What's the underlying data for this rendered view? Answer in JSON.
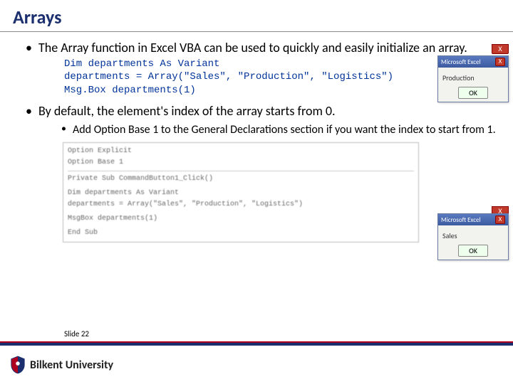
{
  "title": "Arrays",
  "bullets": {
    "b1": "The Array function in Excel VBA can be used to quickly and easily initialize an array.",
    "b2": "By default, the element's index of the array starts from 0.",
    "sub": "Add Option Base 1 to the General Declarations section if you want the index to start from 1."
  },
  "code1": "Dim departments As Variant\ndepartments = Array(\"Sales\", \"Production\", \"Logistics\")\nMsg.Box departments(1)",
  "ide": {
    "l1": "Option Explicit",
    "l2": "Option Base 1",
    "l3": "Private Sub CommandButton1_Click()",
    "l4": "Dim departments As Variant",
    "l5": "departments = Array(\"Sales\", \"Production\", \"Logistics\")",
    "l6": "MsgBox departments(1)",
    "l7": "End Sub"
  },
  "msgbox": {
    "title": "Microsoft Excel",
    "ok": "OK",
    "x": "X",
    "body1": "Production",
    "body2": "Sales"
  },
  "slide": "Slide 22",
  "university": "Bilkent University"
}
